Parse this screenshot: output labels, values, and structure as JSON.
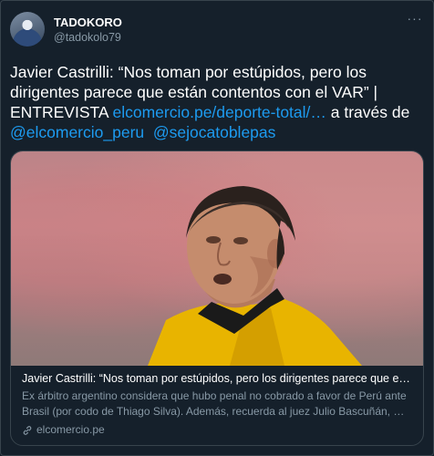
{
  "author": {
    "display_name": "TADOKORO",
    "handle": "@tadokolo79"
  },
  "menu_icon": "more-dots-icon",
  "tweet": {
    "text_main": "Javier Castrilli: “Nos toman por estúpidos, pero los dirigentes parece que están contentos con el VAR” | ENTREVISTA ",
    "link_url_text": "elcomercio.pe/deporte-total/…",
    "text_via": " a través de ",
    "mention_1": "@elcomercio_peru",
    "mention_2": "@sejocatoblepas"
  },
  "card": {
    "title": "Javier Castrilli: “Nos toman por estúpidos, pero los dirigentes parece que están …",
    "description": "Ex árbitro argentino considera que hubo penal no cobrado a favor de Perú ante Brasil (por codo de Thiago Silva). Además, recuerda al juez Julio Bascuñán, …",
    "domain": "elcomercio.pe",
    "domain_icon": "link-icon"
  },
  "colors": {
    "background": "#15202b",
    "link": "#1d9bf0",
    "secondary_text": "#8899a6",
    "border": "#38444d"
  }
}
